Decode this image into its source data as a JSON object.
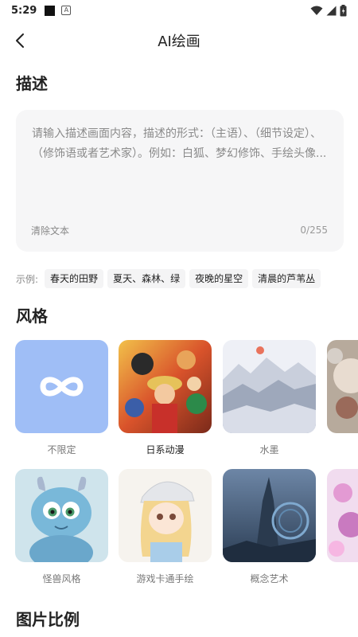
{
  "status_bar": {
    "time": "5:29"
  },
  "nav": {
    "title": "AI绘画"
  },
  "description": {
    "section_title": "描述",
    "placeholder": "请输入描述画面内容，描述的形式：（主语）、（细节设定）、（修饰语或者艺术家）。例如：白狐、梦幻修饰、手绘头像...",
    "clear_label": "清除文本",
    "char_count": "0/255"
  },
  "examples": {
    "label": "示例:",
    "chips": [
      "春天的田野",
      "夏天、森林、绿",
      "夜晚的星空",
      "清晨的芦苇丛"
    ]
  },
  "style": {
    "section_title": "风格",
    "items": [
      {
        "label": "不限定",
        "selected": false,
        "icon": "infinity-icon"
      },
      {
        "label": "日系动漫",
        "selected": true
      },
      {
        "label": "水墨",
        "selected": false
      },
      {
        "label": "",
        "selected": false
      },
      {
        "label": "怪兽风格",
        "selected": false
      },
      {
        "label": "游戏卡通手绘",
        "selected": false
      },
      {
        "label": "概念艺术",
        "selected": false
      },
      {
        "label": "",
        "selected": false
      }
    ],
    "accent_color": "#9fbef6"
  },
  "aspect": {
    "section_title": "图片比例"
  }
}
